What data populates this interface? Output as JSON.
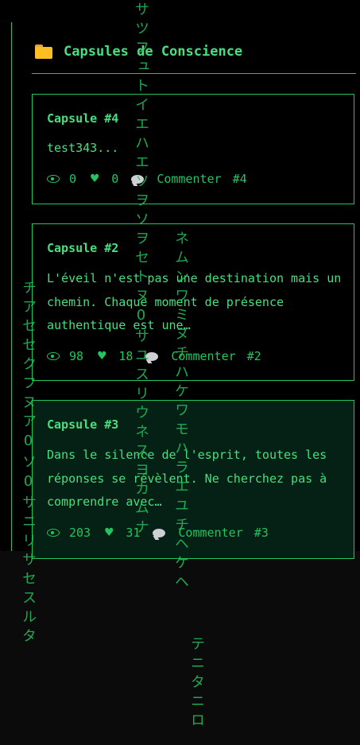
{
  "section_title": "Capsules de Conscience",
  "capsules": [
    {
      "title": "Capsule #4",
      "text": "test343...",
      "views": "0",
      "likes": "0",
      "comment_label": "Commenter",
      "id_label": "#4"
    },
    {
      "title": "Capsule #2",
      "text": "L'éveil n'est pas une destination mais un chemin. Chaque moment de présence authentique est une…",
      "views": "98",
      "likes": "18",
      "comment_label": "Commenter",
      "id_label": "#2"
    },
    {
      "title": "Capsule #3",
      "text": "Dans le silence de l'esprit, toutes les réponses se révèlent. Ne cherchez pas à comprendre avec…",
      "views": "203",
      "likes": "31",
      "comment_label": "Commenter",
      "id_label": "#3"
    }
  ],
  "matrix_rain": {
    "col_a": "チアセセクフヌア0ソ0サニリサセスルタ",
    "col_b": "サツフュトイエハエソヲソヲセトヌ0サユスリウネスヨカムナ",
    "col_c": "ネムンワミヌチハケワモハラエユチヘケヘ",
    "col_d": "テニタニロ"
  },
  "colors": {
    "accent": "#4ade80",
    "border": "#22c55e",
    "background": "#000000"
  },
  "icons": {
    "folder": "folder-icon",
    "views": "eye-icon",
    "likes": "green-heart-icon",
    "comment": "speech-bubble-icon"
  }
}
